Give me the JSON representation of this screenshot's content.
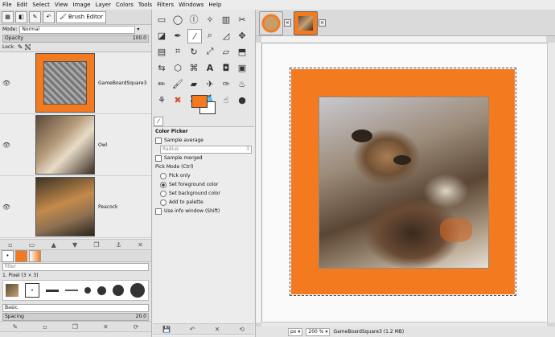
{
  "menubar": [
    "File",
    "Edit",
    "Select",
    "View",
    "Image",
    "Layer",
    "Colors",
    "Tools",
    "Filters",
    "Windows",
    "Help"
  ],
  "left_dock": {
    "tab_brush_editor": "Brush Editor",
    "mode_label": "Mode:",
    "mode_value": "Normal",
    "opacity_label": "Opacity",
    "opacity_value": "100.0",
    "lock_label": "Lock:",
    "layers": [
      {
        "name": "GameBoardSquare3"
      },
      {
        "name": "Owl"
      },
      {
        "name": "Peacock"
      }
    ],
    "brushes": {
      "filter_placeholder": "filter",
      "brush_name": "1. Pixel (3 × 3)",
      "preset_label": "Basic.",
      "spacing_label": "Spacing",
      "spacing_value": "20.0"
    }
  },
  "tool_options": {
    "title": "Color Picker",
    "sample_average": "Sample average",
    "radius_label": "Radius",
    "radius_value": "3",
    "sample_merged": "Sample merged",
    "pick_mode_label": "Pick Mode (Ctrl)",
    "pick_modes": [
      "Pick only",
      "Set foreground color",
      "Set background color",
      "Add to palette"
    ],
    "selected_pick_mode": "Set foreground color",
    "use_info_window": "Use info window (Shift)"
  },
  "colors": {
    "foreground": "#f47a20",
    "background": "#ffffff",
    "accent": "#f47a20"
  },
  "status": {
    "unit": "px",
    "zoom": "200 %",
    "info": "GameBoardSquare3 (1.2 MB)"
  }
}
